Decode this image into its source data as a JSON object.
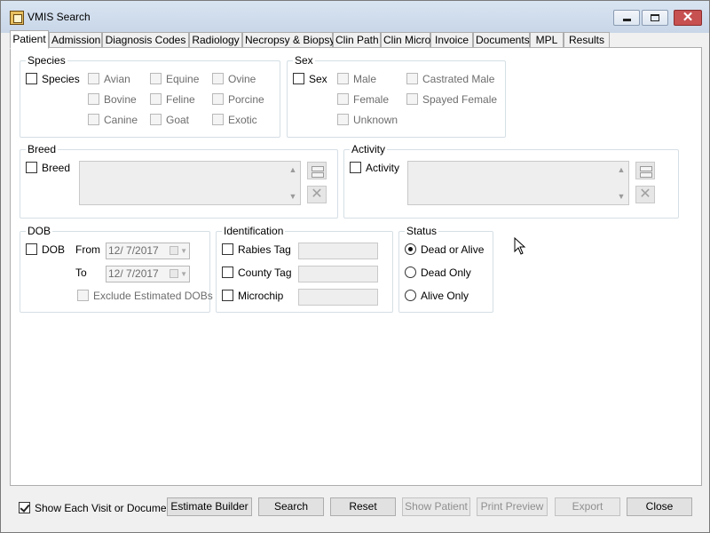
{
  "window": {
    "title": "VMIS Search"
  },
  "tabs": [
    "Patient",
    "Admission",
    "Diagnosis Codes",
    "Radiology",
    "Necropsy & Biopsy",
    "Clin Path",
    "Clin Micro",
    "Invoice",
    "Documents",
    "MPL",
    "Results"
  ],
  "species": {
    "group_label": "Species",
    "toggle_label": "Species",
    "options": [
      "Avian",
      "Equine",
      "Ovine",
      "Bovine",
      "Feline",
      "Porcine",
      "Canine",
      "Goat",
      "Exotic"
    ]
  },
  "sex": {
    "group_label": "Sex",
    "toggle_label": "Sex",
    "options": [
      "Male",
      "Castrated Male",
      "Female",
      "Spayed Female",
      "Unknown"
    ]
  },
  "breed": {
    "group_label": "Breed",
    "toggle_label": "Breed"
  },
  "activity": {
    "group_label": "Activity",
    "toggle_label": "Activity"
  },
  "dob": {
    "group_label": "DOB",
    "toggle_label": "DOB",
    "from_label": "From",
    "to_label": "To",
    "from_value": "12/ 7/2017",
    "to_value": "12/ 7/2017",
    "exclude_label": "Exclude Estimated DOBs"
  },
  "identification": {
    "group_label": "Identification",
    "items": [
      "Rabies Tag",
      "County Tag",
      "Microchip"
    ]
  },
  "status": {
    "group_label": "Status",
    "options": [
      "Dead or Alive",
      "Dead Only",
      "Alive Only"
    ],
    "selected": "Dead or Alive"
  },
  "footer": {
    "show_each_label": "Show Each Visit or Document",
    "show_each_checked": true,
    "buttons": {
      "estimate_builder": "Estimate Builder",
      "search": "Search",
      "reset": "Reset",
      "show_patient": "Show Patient",
      "print_preview": "Print Preview",
      "export": "Export",
      "close": "Close"
    }
  }
}
